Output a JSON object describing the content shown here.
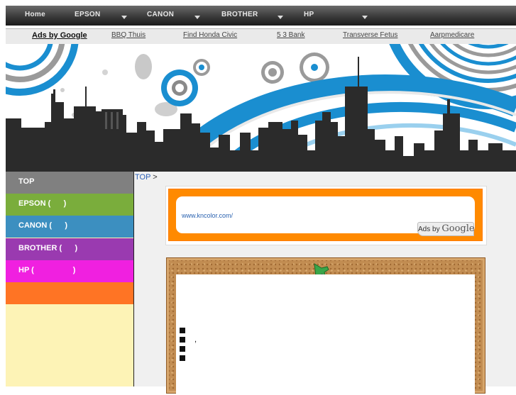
{
  "nav": {
    "items": [
      "Home",
      "EPSON",
      "CANON",
      "BROTHER",
      "HP"
    ]
  },
  "ads_bar": {
    "ads_by": "Ads by Google",
    "links": [
      "BBQ Thuis",
      "Find Honda Civic",
      "5 3 Bank",
      "Transverse Fetus",
      "Aarpmedicare"
    ]
  },
  "sidebar": {
    "items": [
      {
        "label": "TOP",
        "color": "#808080"
      },
      {
        "label": "EPSON (      )",
        "color": "#7aad3c"
      },
      {
        "label": "CANON (      )",
        "color": "#3c8fc0"
      },
      {
        "label": "BROTHER (      )",
        "color": "#9a3ab0"
      },
      {
        "label": "HP (                  )",
        "color": "#f020e0"
      },
      {
        "label": "",
        "color": "#ff7424"
      }
    ]
  },
  "breadcrumb": {
    "link": "TOP",
    "separator": ">"
  },
  "ad": {
    "url": "www.kncolor.com/",
    "ads_by": "Ads by",
    "google": "Google"
  },
  "colors": {
    "banner_blue": "#1a8ed0",
    "skyline": "#2b2b2b"
  },
  "note": {
    "comma": ","
  }
}
